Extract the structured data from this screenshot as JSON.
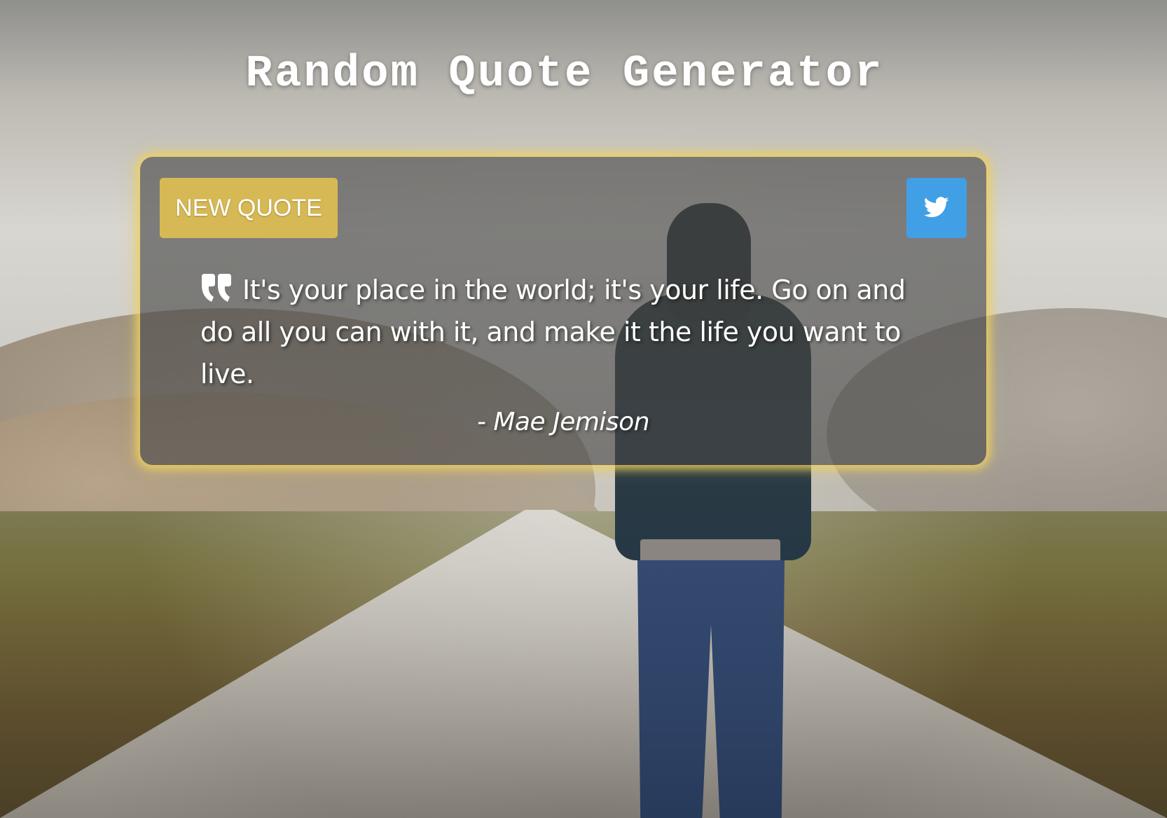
{
  "header": {
    "title": "Random Quote Generator"
  },
  "card": {
    "new_quote_label": "NEW QUOTE",
    "tweet_icon": "twitter-icon",
    "quote_icon": "quote-left-icon",
    "quote_text": "It's your place in the world; it's your life. Go on and do all you can with it, and make it the life you want to live.",
    "author": "- Mae Jemison"
  },
  "colors": {
    "new_quote_button": "#d6b954",
    "tweet_button": "#419fe6",
    "card_glow": "#f0d05a",
    "card_background": "rgba(70,70,70,0.62)",
    "text": "#ffffff"
  }
}
